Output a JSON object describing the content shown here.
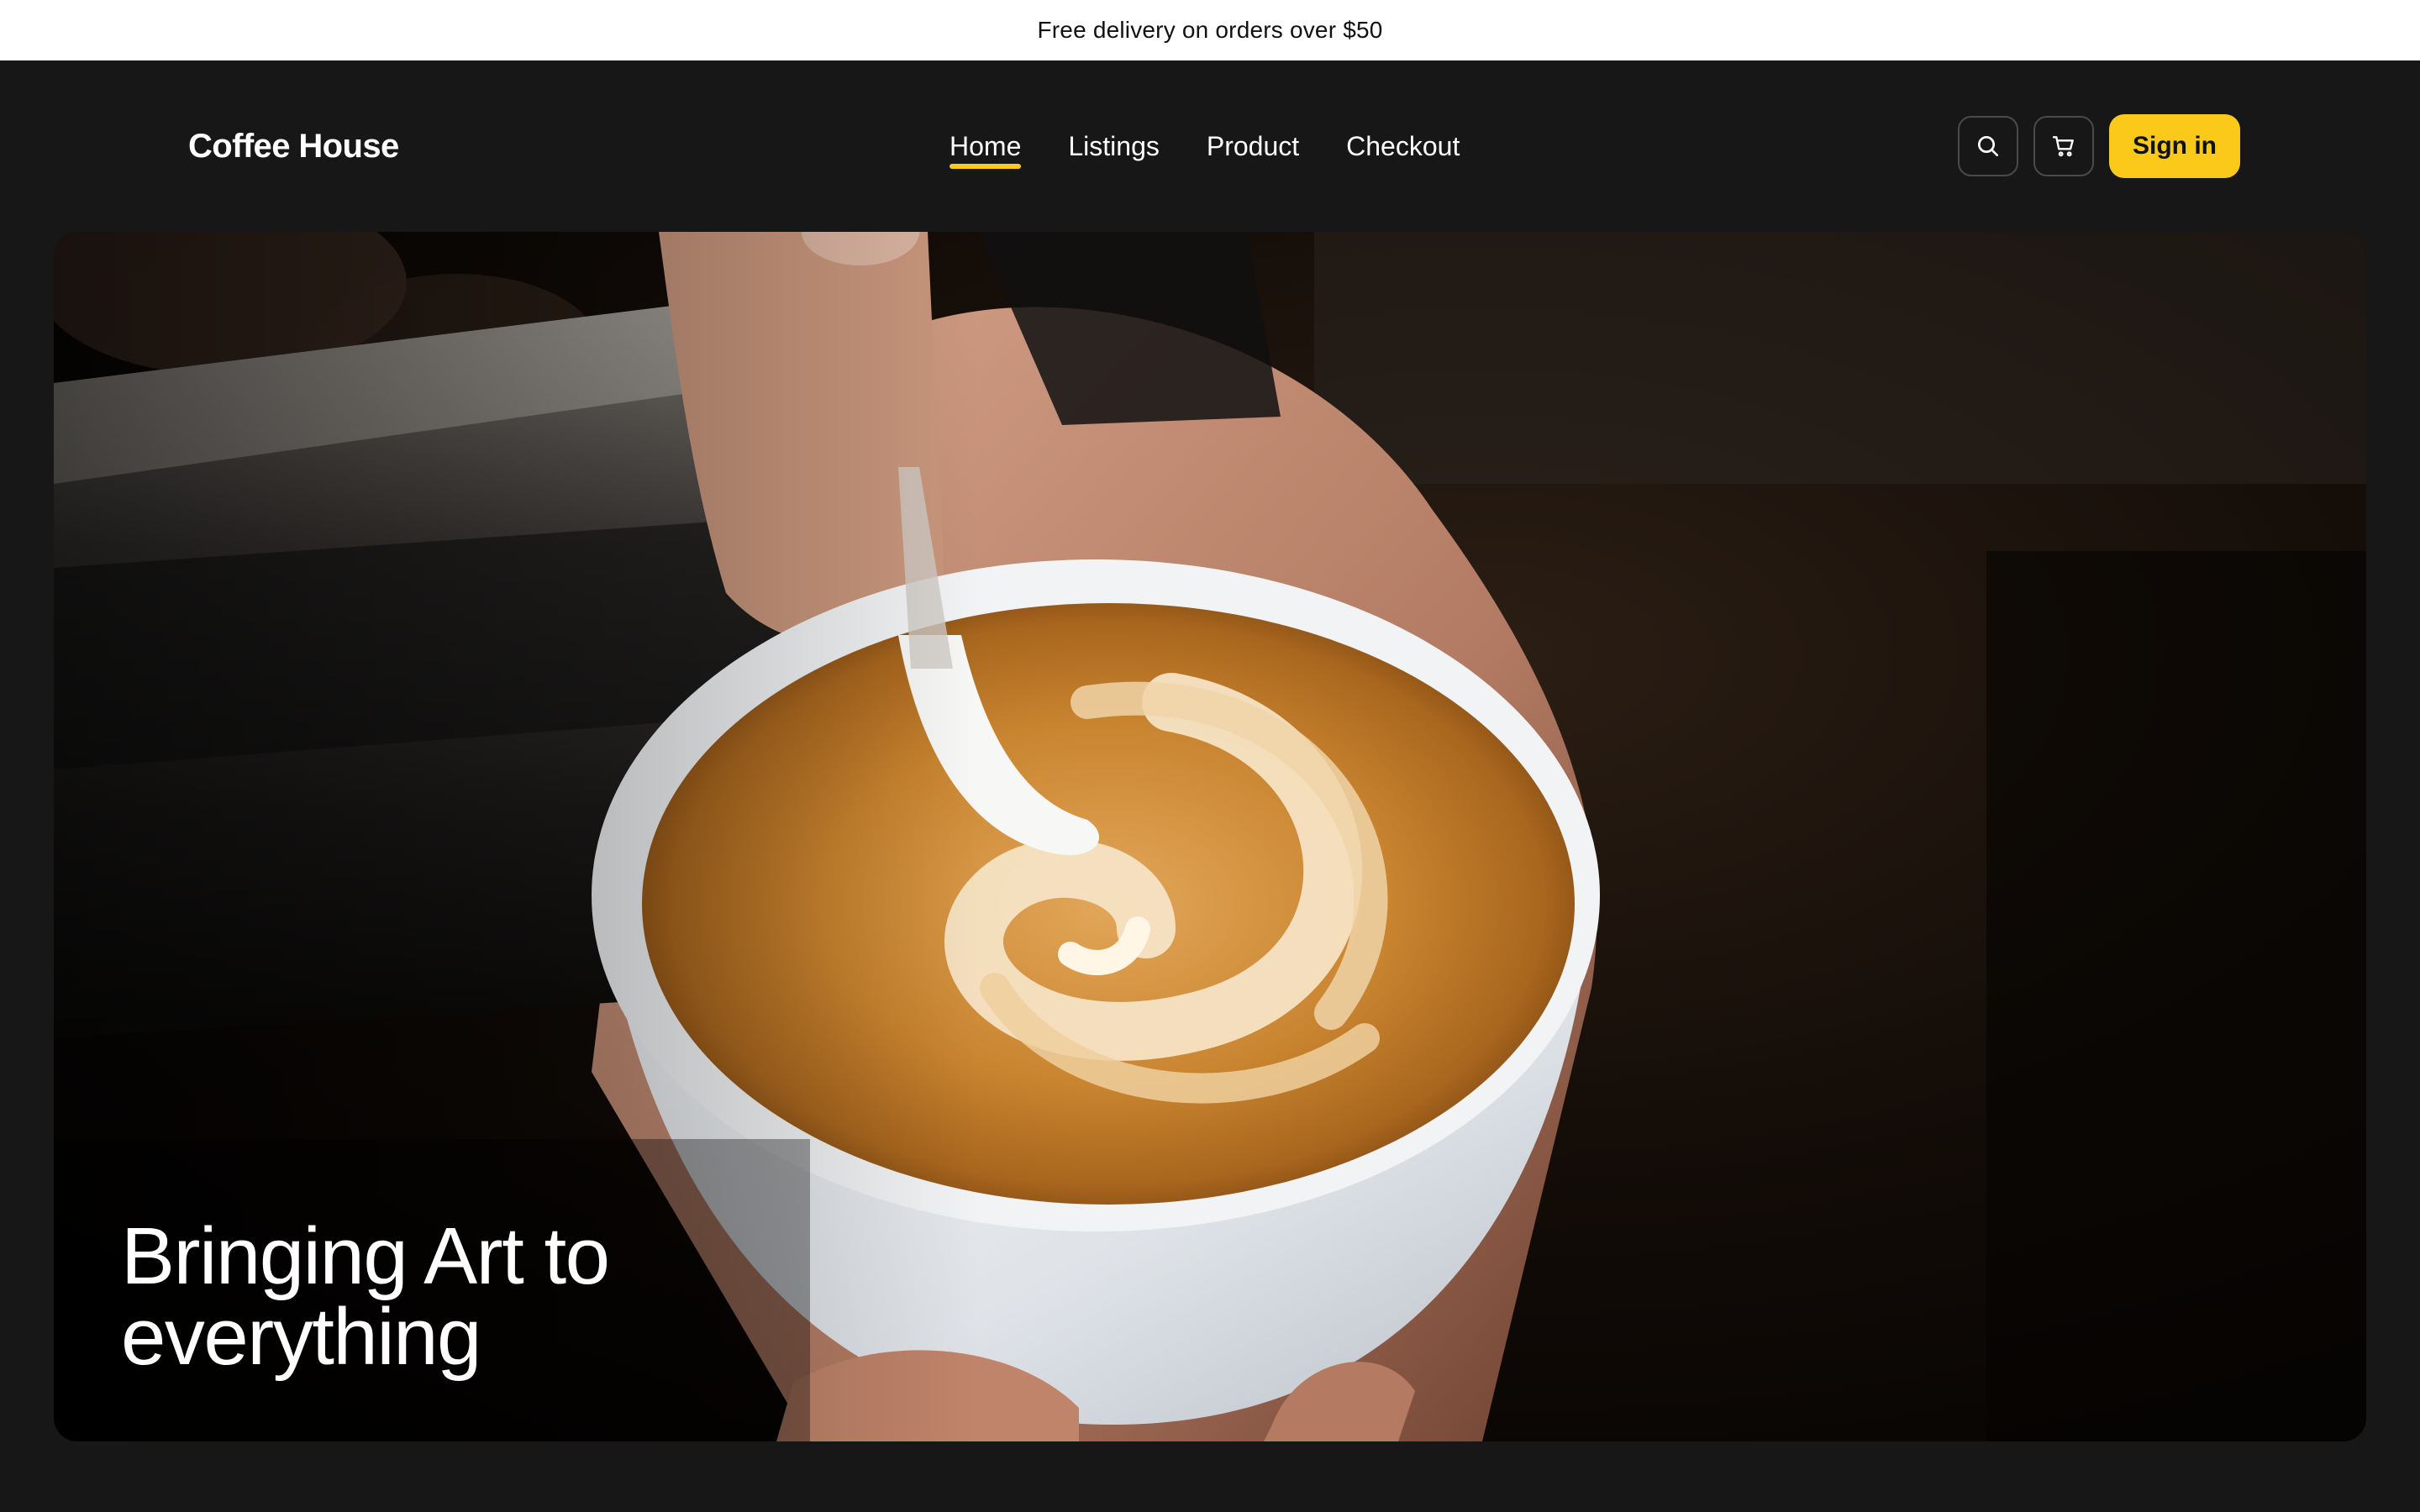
{
  "announcement": {
    "text": "Free delivery on orders over $50"
  },
  "header": {
    "brand": "Coffee House",
    "nav": [
      {
        "label": "Home",
        "active": true
      },
      {
        "label": "Listings",
        "active": false
      },
      {
        "label": "Product",
        "active": false
      },
      {
        "label": "Checkout",
        "active": false
      }
    ],
    "search_icon": "search-icon",
    "cart_icon": "cart-icon",
    "signin_label": "Sign in"
  },
  "hero": {
    "title_line1": "Bringing Art to",
    "title_line2": "everything",
    "image": "latte-art-pour-photo"
  },
  "colors": {
    "accent": "#fbc91a",
    "background": "#171717",
    "announcement_bg": "#ffffff",
    "text_light": "#ffffff"
  }
}
